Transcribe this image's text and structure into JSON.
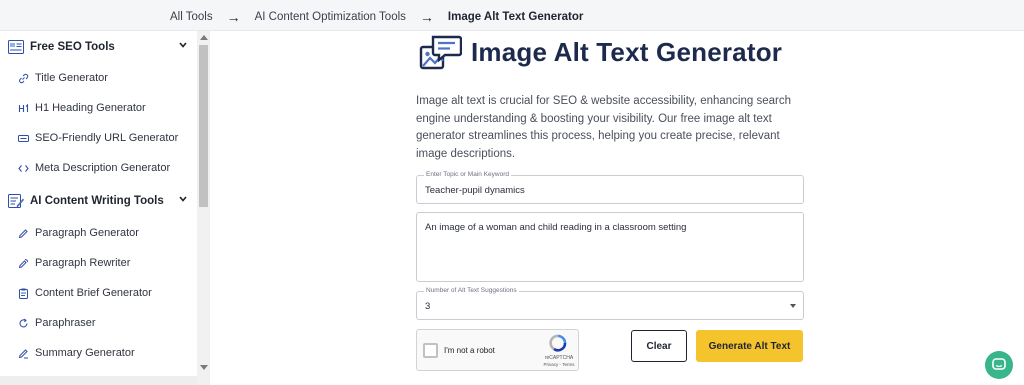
{
  "breadcrumb": {
    "items": [
      "All Tools",
      "AI Content Optimization Tools",
      "Image Alt Text Generator"
    ],
    "separator_icon": "arrow-right-icon"
  },
  "sidebar": {
    "groups": [
      {
        "label": "Free SEO Tools",
        "icon": "seo-tools-icon",
        "items": [
          "Title Generator",
          "H1 Heading Generator",
          "SEO-Friendly URL Generator",
          "Meta Description Generator"
        ]
      },
      {
        "label": "AI Content Writing Tools",
        "icon": "writing-tools-icon",
        "items": [
          "Paragraph Generator",
          "Paragraph Rewriter",
          "Content Brief Generator",
          "Paraphraser",
          "Summary Generator"
        ]
      }
    ]
  },
  "main": {
    "title": "Image Alt Text Generator",
    "title_icon": "image-chat-icon",
    "intro": "Image alt text is crucial for SEO & website accessibility, enhancing search engine understanding & boosting your visibility. Our free image alt text generator streamlines this process, helping you create precise, relevant image descriptions.",
    "topic_label": "Enter Topic or Main Keyword",
    "topic_value": "Teacher-pupil dynamics",
    "description_value": "An image of a woman and child reading in a classroom setting",
    "count_label": "Number of Alt Text Suggestions",
    "count_value": "3",
    "recaptcha_label": "I'm not a robot",
    "recaptcha_brand": "reCAPTCHA",
    "recaptcha_terms": "Privacy - Terms",
    "clear_label": "Clear",
    "generate_label": "Generate Alt Text"
  },
  "colors": {
    "title": "#1d2a4d",
    "accent_button": "#f5c42c",
    "chat_button": "#38b58a",
    "icon_blue": "#2f4fa8"
  }
}
